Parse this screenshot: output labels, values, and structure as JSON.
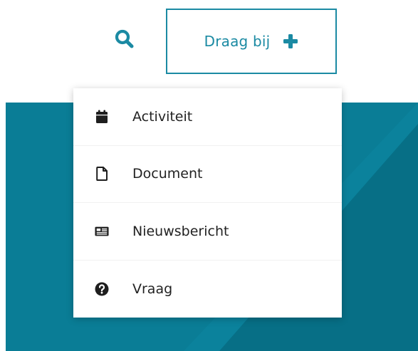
{
  "colors": {
    "accent": "#1b8aa3",
    "hero_background": "#0a7d96",
    "menu_text": "#222222",
    "menu_icon": "#1e1e1e"
  },
  "header": {
    "search": {
      "icon": "search-icon"
    },
    "contribute": {
      "label": "Draag bij",
      "icon": "plus-icon"
    }
  },
  "dropdown": {
    "items": [
      {
        "label": "Activiteit",
        "icon": "calendar-icon"
      },
      {
        "label": "Document",
        "icon": "file-icon"
      },
      {
        "label": "Nieuwsbericht",
        "icon": "newspaper-icon"
      },
      {
        "label": "Vraag",
        "icon": "question-circle-icon"
      }
    ]
  }
}
